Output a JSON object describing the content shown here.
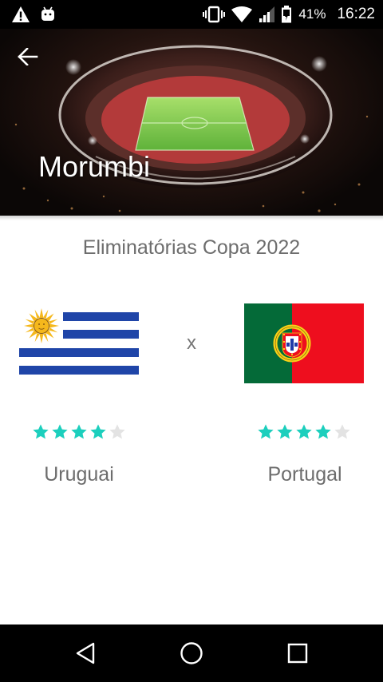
{
  "status_bar": {
    "battery": "41%",
    "time": "16:22",
    "icons": [
      "warning-icon",
      "android-icon",
      "vibrate-icon",
      "wifi-icon",
      "signal-icon",
      "battery-icon"
    ]
  },
  "header": {
    "venue": "Morumbi",
    "back_icon": "arrow-back-icon"
  },
  "match": {
    "competition": "Eliminatórias Copa 2022",
    "separator": "x",
    "home": {
      "name": "Uruguai",
      "flag": "uruguay-flag",
      "rating": 4,
      "max_rating": 5
    },
    "away": {
      "name": "Portugal",
      "flag": "portugal-flag",
      "rating": 4,
      "max_rating": 5
    }
  },
  "colors": {
    "star_filled": "#1ccfbd",
    "star_empty": "#e3e3e3",
    "text_secondary": "#6d6d6d",
    "uruguay_blue": "#1f45a8",
    "uruguay_sun": "#f5b81c",
    "portugal_green": "#046a38",
    "portugal_red": "#ee0e1e"
  },
  "nav_bar": {
    "icons": [
      "nav-back-icon",
      "nav-home-icon",
      "nav-recent-icon"
    ]
  }
}
